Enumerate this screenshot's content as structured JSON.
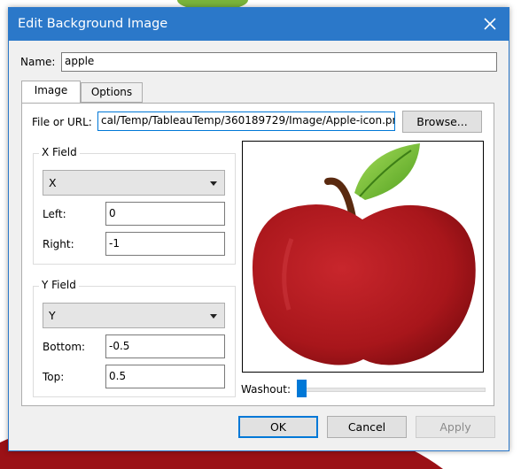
{
  "dialog": {
    "title": "Edit Background Image",
    "name_label": "Name:",
    "name_value": "apple"
  },
  "tabs": [
    {
      "label": "Image",
      "active": true
    },
    {
      "label": "Options",
      "active": false
    }
  ],
  "image_tab": {
    "file_label": "File or URL:",
    "file_value": "cal/Temp/TableauTemp/360189729/Image/Apple-icon.png",
    "browse_label": "Browse...",
    "x_field": {
      "title": "X Field",
      "selected": "X",
      "left_label": "Left:",
      "left_value": "0",
      "right_label": "Right:",
      "right_value": "-1"
    },
    "y_field": {
      "title": "Y Field",
      "selected": "Y",
      "bottom_label": "Bottom:",
      "bottom_value": "-0.5",
      "top_label": "Top:",
      "top_value": "0.5"
    },
    "preview_icon": "apple-image",
    "washout_label": "Washout:",
    "washout_value": 0
  },
  "buttons": {
    "ok": "OK",
    "cancel": "Cancel",
    "apply": "Apply"
  },
  "colors": {
    "titlebar": "#2b78c9",
    "accent": "#0078d7",
    "apple_red": "#b01a1f",
    "leaf_green": "#6fbf2e"
  }
}
